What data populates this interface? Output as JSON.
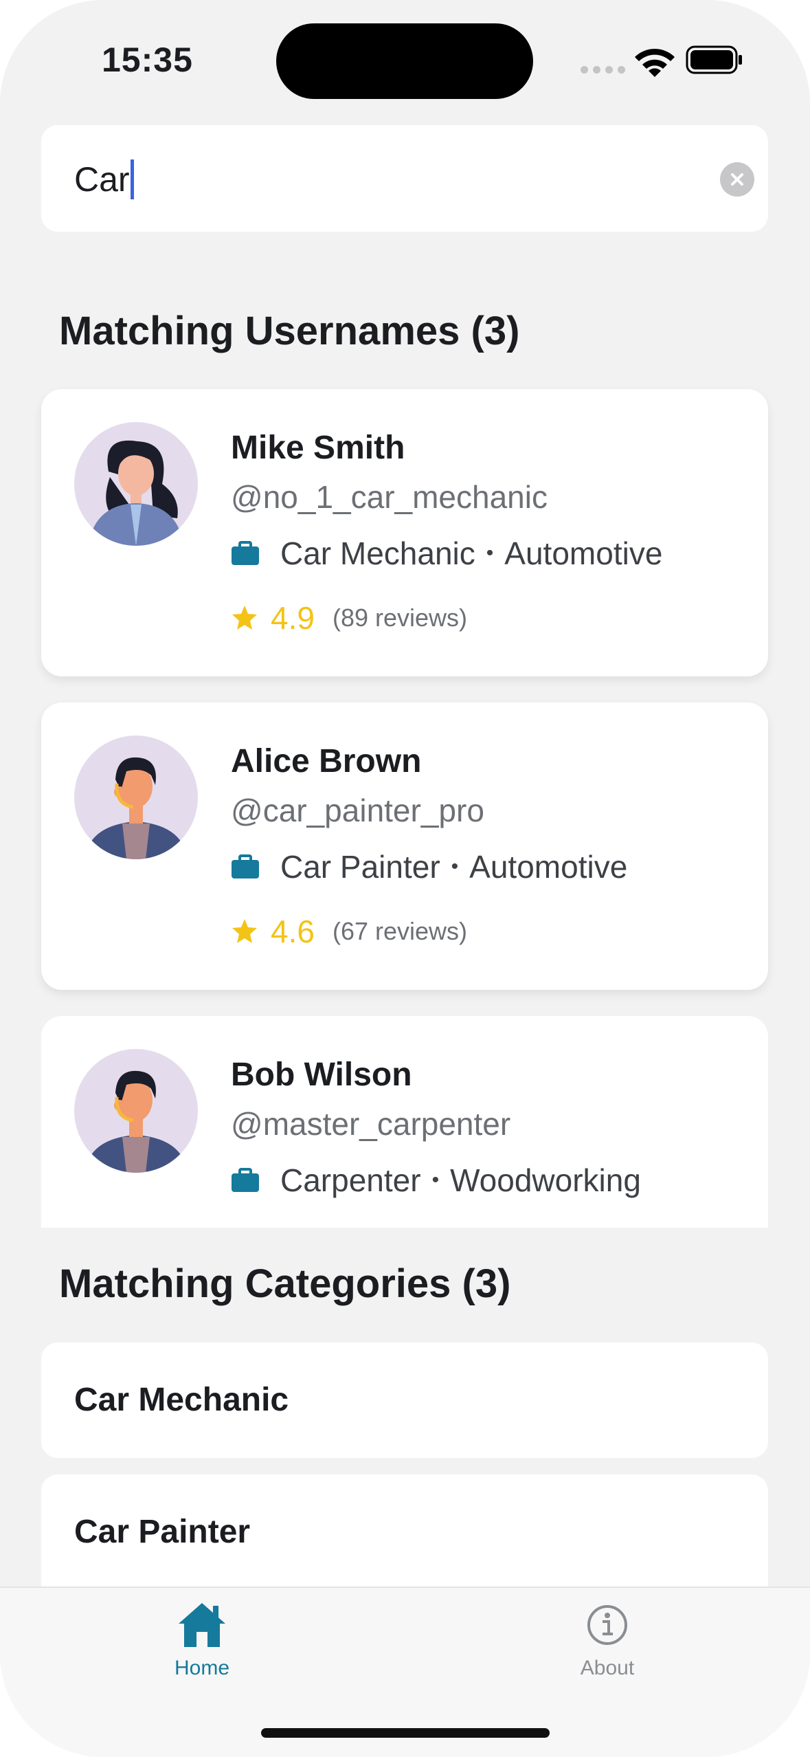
{
  "status_bar": {
    "time": "15:35"
  },
  "search": {
    "value": "Car"
  },
  "usernames_section": {
    "title": "Matching Usernames (3)"
  },
  "users": [
    {
      "name": "Mike Smith",
      "handle": "@no_1_car_mechanic",
      "profession": "Car Mechanic",
      "category": "Automotive",
      "rating": "4.9",
      "reviews": "(89 reviews)"
    },
    {
      "name": "Alice Brown",
      "handle": "@car_painter_pro",
      "profession": "Car Painter",
      "category": "Automotive",
      "rating": "4.6",
      "reviews": "(67 reviews)"
    },
    {
      "name": "Bob Wilson",
      "handle": "@master_carpenter",
      "profession": "Carpenter",
      "category": "Woodworking"
    }
  ],
  "categories_section": {
    "title": "Matching Categories (3)"
  },
  "categories": [
    {
      "label": "Car Mechanic"
    },
    {
      "label": "Car Painter"
    }
  ],
  "tab_bar": {
    "home_label": "Home",
    "about_label": "About"
  },
  "colors": {
    "accent": "#157a9c",
    "star": "#f3c316",
    "inactive": "#8a8d91"
  }
}
